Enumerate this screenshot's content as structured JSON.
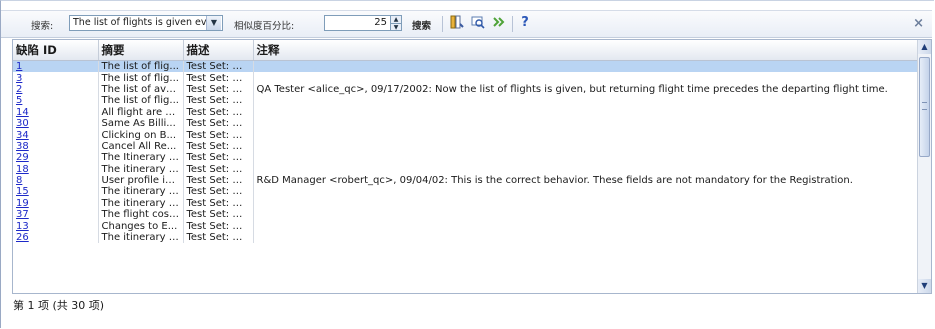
{
  "toolbar": {
    "search_label": "搜索:",
    "search_value": "The list of flights is given even",
    "similarity_label": "相似度百分比:",
    "similarity_value": "25",
    "search_button": "搜索",
    "help": "?",
    "close": "×"
  },
  "grid": {
    "headers": [
      "缺陷 ID",
      "摘要",
      "描述",
      "注释"
    ],
    "rows": [
      {
        "id": "1",
        "summary": "The list of flig...",
        "desc": "Test Set: Mer...",
        "comment": ""
      },
      {
        "id": "3",
        "summary": "The list of flig...",
        "desc": "Test Set: Mer...",
        "comment": ""
      },
      {
        "id": "2",
        "summary": "The list of ava...",
        "desc": "Test Set: Mer...",
        "comment": "QA Tester <alice_qc>, 09/17/2002:  Now the list of flights is given, but returning flight time precedes the departing flight time."
      },
      {
        "id": "5",
        "summary": "The list of flig...",
        "desc": "Test Set: Mer...",
        "comment": ""
      },
      {
        "id": "14",
        "summary": "All flight are s...",
        "desc": "Test Set: Mer...",
        "comment": ""
      },
      {
        "id": "30",
        "summary": "Same As Billi...",
        "desc": "Test Set: Mer...",
        "comment": ""
      },
      {
        "id": "34",
        "summary": "Clicking on B...",
        "desc": "Test Set: Mer...",
        "comment": ""
      },
      {
        "id": "38",
        "summary": "Cancel All Re...",
        "desc": "Test Set: Mer...",
        "comment": ""
      },
      {
        "id": "29",
        "summary": "The Itinerary i...",
        "desc": "Test Set: Mer...",
        "comment": ""
      },
      {
        "id": "18",
        "summary": "The itinerary i...",
        "desc": "Test Set: Mer...",
        "comment": ""
      },
      {
        "id": "8",
        "summary": "User profile is...",
        "desc": "Test Set: Mer...",
        "comment": "R&D Manager <robert_qc>,  09/04/02: This is the correct behavior. These fields are not mandatory for the Registration."
      },
      {
        "id": "15",
        "summary": "The itinerary i...",
        "desc": "Test Set: Mer...",
        "comment": ""
      },
      {
        "id": "19",
        "summary": "The itinerary i...",
        "desc": "Test Set: Mer...",
        "comment": ""
      },
      {
        "id": "37",
        "summary": "The flight cost...",
        "desc": "Test Set: Mer...",
        "comment": ""
      },
      {
        "id": "13",
        "summary": "Changes to E...",
        "desc": "Test Set: Mer...",
        "comment": ""
      },
      {
        "id": "26",
        "summary": "The itinerary i...",
        "desc": "Test Set: Mer...",
        "comment": ""
      }
    ]
  },
  "status": "第 1 项 (共 30 项)"
}
